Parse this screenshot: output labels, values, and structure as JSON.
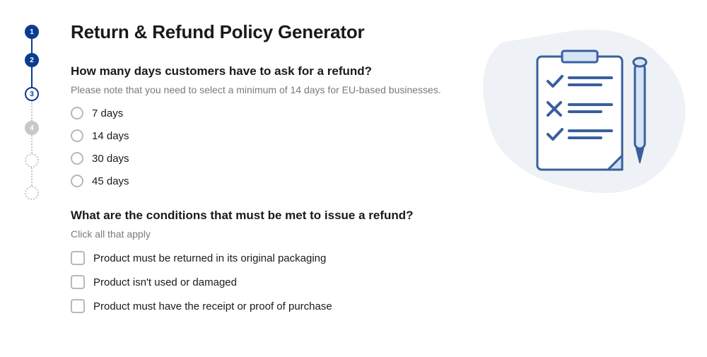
{
  "stepper": {
    "steps": [
      "1",
      "2",
      "3",
      "4"
    ]
  },
  "title": "Return & Refund Policy Generator",
  "q1": {
    "title": "How many days customers have to ask for a refund?",
    "hint": "Please note that you need to select a minimum of 14 days for EU-based businesses.",
    "options": [
      "7 days",
      "14 days",
      "30 days",
      "45 days"
    ]
  },
  "q2": {
    "title": "What are the conditions that must be met to issue a refund?",
    "hint": "Click all that apply",
    "options": [
      "Product must be returned in its original packaging",
      "Product isn't used or damaged",
      "Product must have the receipt or proof of purchase"
    ]
  }
}
